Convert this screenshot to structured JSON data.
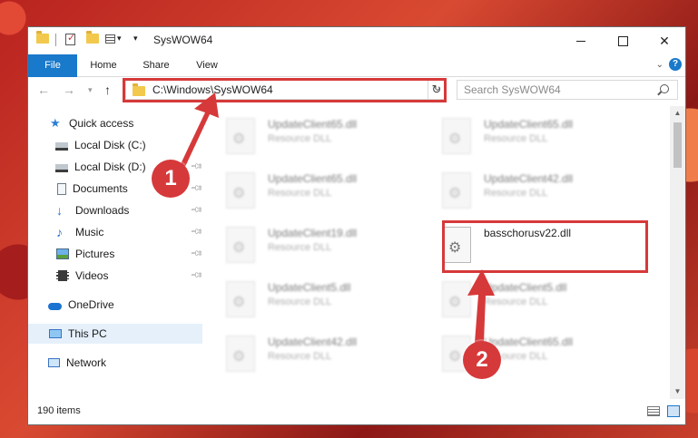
{
  "window": {
    "title": "SysWOW64",
    "controls": {
      "minimize": "minimize",
      "maximize": "maximize",
      "close": "✕"
    }
  },
  "ribbon": {
    "tabs": [
      "File",
      "Home",
      "Share",
      "View"
    ],
    "help": "?"
  },
  "nav": {
    "address_path": "C:\\Windows\\SysWOW64",
    "search_placeholder": "Search SysWOW64"
  },
  "sidebar": {
    "items": [
      {
        "label": "Quick access",
        "icon": "star-icon"
      },
      {
        "label": "Local Disk (C:)",
        "icon": "disk-icon"
      },
      {
        "label": "Local Disk (D:)",
        "icon": "disk-icon"
      },
      {
        "label": "Documents",
        "icon": "documents-icon"
      },
      {
        "label": "Downloads",
        "icon": "download-icon"
      },
      {
        "label": "Music",
        "icon": "music-icon"
      },
      {
        "label": "Pictures",
        "icon": "pictures-icon"
      },
      {
        "label": "Videos",
        "icon": "videos-icon"
      },
      {
        "label": "OneDrive",
        "icon": "cloud-icon"
      },
      {
        "label": "This PC",
        "icon": "computer-icon"
      },
      {
        "label": "Network",
        "icon": "network-icon"
      }
    ]
  },
  "files": [
    {
      "name": "UpdateClient65.dll",
      "type": "Resource DLL"
    },
    {
      "name": "UpdateClient65.dll",
      "type": "Resource DLL"
    },
    {
      "name": "UpdateClient65.dll",
      "type": "Resource DLL"
    },
    {
      "name": "UpdateClient42.dll",
      "type": "Resource DLL"
    },
    {
      "name": "UpdateClient19.dll",
      "type": "Resource DLL"
    },
    {
      "name": "basschorusv22.dll",
      "type": ""
    },
    {
      "name": "UpdateClient5.dll",
      "type": "Resource DLL"
    },
    {
      "name": "UpdateClient5.dll",
      "type": "Resource DLL"
    },
    {
      "name": "UpdateClient42.dll",
      "type": "Resource DLL"
    },
    {
      "name": "UpdateClient65.dll",
      "type": "Resource DLL"
    }
  ],
  "status": {
    "item_count": "190 items"
  },
  "annotations": {
    "step1": "1",
    "step2": "2",
    "color": "#d6393a"
  },
  "colors": {
    "accent": "#1979ca",
    "highlight": "#d6393a",
    "selected_bg": "#e5f0fb"
  }
}
